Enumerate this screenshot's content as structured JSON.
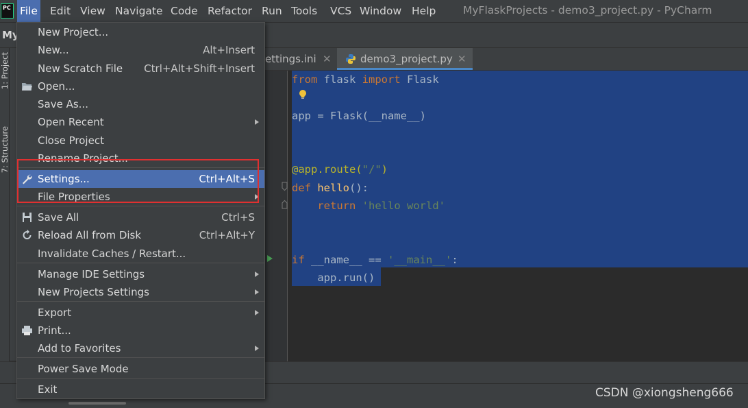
{
  "menubar": {
    "app_icon": "pycharm-logo",
    "app_icon_text": "PC",
    "items": [
      "File",
      "Edit",
      "View",
      "Navigate",
      "Code",
      "Refactor",
      "Run",
      "Tools",
      "VCS",
      "Window",
      "Help"
    ],
    "window_title": "MyFlaskProjects - demo3_project.py - PyCharm"
  },
  "navbar": {
    "project_label": "My"
  },
  "tool_strip": {
    "project_tab": "1: Project",
    "structure_tab": "7: Structure"
  },
  "tabs": [
    {
      "label": "ettings.ini",
      "active": false
    },
    {
      "label": "demo3_project.py",
      "active": true
    }
  ],
  "file_menu": {
    "items": [
      {
        "label": "New Project...",
        "shortcut": "",
        "submenu": false,
        "icon": ""
      },
      {
        "label": "New...",
        "shortcut": "Alt+Insert",
        "submenu": false,
        "icon": ""
      },
      {
        "label": "New Scratch File",
        "shortcut": "Ctrl+Alt+Shift+Insert",
        "submenu": false,
        "icon": ""
      },
      {
        "label": "Open...",
        "shortcut": "",
        "submenu": false,
        "icon": "folder-icon"
      },
      {
        "label": "Save As...",
        "shortcut": "",
        "submenu": false,
        "icon": ""
      },
      {
        "label": "Open Recent",
        "shortcut": "",
        "submenu": true,
        "icon": ""
      },
      {
        "label": "Close Project",
        "shortcut": "",
        "submenu": false,
        "icon": ""
      },
      {
        "label": "Rename Project...",
        "shortcut": "",
        "submenu": false,
        "icon": ""
      },
      {
        "label": "Settings...",
        "shortcut": "Ctrl+Alt+S",
        "submenu": false,
        "icon": "wrench-icon",
        "selected": true
      },
      {
        "label": "File Properties",
        "shortcut": "",
        "submenu": true,
        "icon": ""
      },
      {
        "label": "Save All",
        "shortcut": "Ctrl+S",
        "submenu": false,
        "icon": "save-icon"
      },
      {
        "label": "Reload All from Disk",
        "shortcut": "Ctrl+Alt+Y",
        "submenu": false,
        "icon": "reload-icon"
      },
      {
        "label": "Invalidate Caches / Restart...",
        "shortcut": "",
        "submenu": false,
        "icon": ""
      },
      {
        "label": "Manage IDE Settings",
        "shortcut": "",
        "submenu": true,
        "icon": ""
      },
      {
        "label": "New Projects Settings",
        "shortcut": "",
        "submenu": true,
        "icon": ""
      },
      {
        "label": "Export",
        "shortcut": "",
        "submenu": true,
        "icon": ""
      },
      {
        "label": "Print...",
        "shortcut": "",
        "submenu": false,
        "icon": "printer-icon"
      },
      {
        "label": "Add to Favorites",
        "shortcut": "",
        "submenu": true,
        "icon": ""
      },
      {
        "label": "Power Save Mode",
        "shortcut": "",
        "submenu": false,
        "icon": ""
      },
      {
        "label": "Exit",
        "shortcut": "",
        "submenu": false,
        "icon": ""
      }
    ]
  },
  "editor": {
    "lines": [
      "from flask import Flask",
      "",
      "app = Flask(__name__)",
      "",
      "",
      "@app.route(\"/\")",
      "def hello():",
      "    return 'hello world'",
      "",
      "",
      "if __name__ == '__main__':",
      "    app.run()"
    ],
    "tokens": {
      "l0_from": "from",
      "l0_mid": " flask ",
      "l0_import": "import",
      "l0_end": " Flask",
      "l2": "app = Flask(__name__)",
      "l5_dec": "@app.route(",
      "l5_str": "\"/\"",
      "l5_end": ")",
      "l6_def": "def",
      "l6_sp": " ",
      "l6_fn": "hello",
      "l6_end": "():",
      "l7_ind": "    ",
      "l7_ret": "return",
      "l7_sp": " ",
      "l7_str": "'hello world'",
      "l10_if": "if",
      "l10_mid": " __name__ == ",
      "l10_str": "'__main__'",
      "l10_end": ":",
      "l11": "    app.run()"
    },
    "selection_color": "#214283"
  },
  "watermark": "CSDN @xiongsheng666",
  "colors": {
    "accent": "#4b6eaf",
    "highlight_box": "#e03030",
    "keyword": "#cc7832",
    "string": "#6a8759",
    "function": "#ffc66d",
    "decorator": "#bbb529"
  }
}
